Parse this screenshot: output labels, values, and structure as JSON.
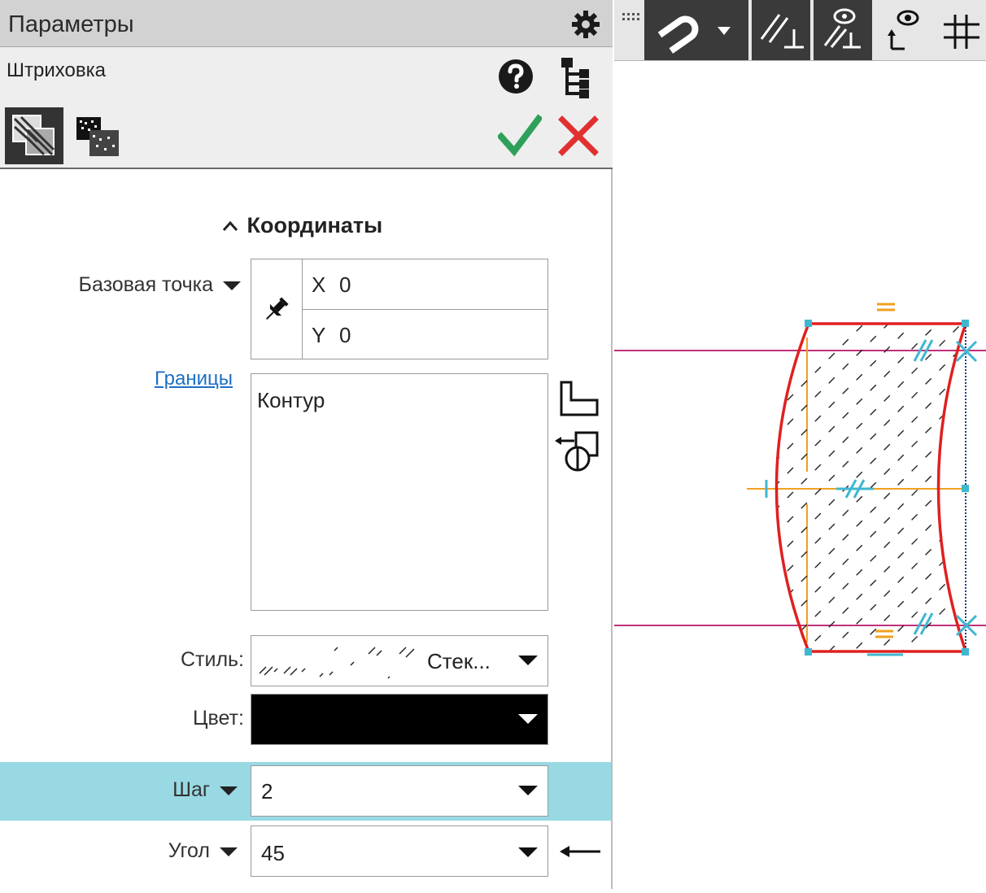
{
  "panel": {
    "title": "Параметры",
    "command": "Штриховка"
  },
  "coordinates": {
    "section_title": "Координаты",
    "base_point_label": "Базовая точка",
    "x_label": "X",
    "x_value": "0",
    "y_label": "Y",
    "y_value": "0"
  },
  "boundaries": {
    "link_label": "Границы",
    "items": [
      "Контур"
    ]
  },
  "style": {
    "label": "Стиль:",
    "value": "Стек..."
  },
  "color": {
    "label": "Цвет:",
    "value_hex": "#000000"
  },
  "step": {
    "label": "Шаг",
    "value": "2"
  },
  "angle": {
    "label": "Угол",
    "value": "45"
  },
  "colors": {
    "accent_check": "#2ea05a",
    "accent_cancel": "#e03030",
    "highlight_row": "#98d9e3",
    "contour_red": "#e02020",
    "axis_orange": "#f0a020",
    "line_magenta": "#c0307a",
    "constraint_cyan": "#3fb7d0"
  }
}
